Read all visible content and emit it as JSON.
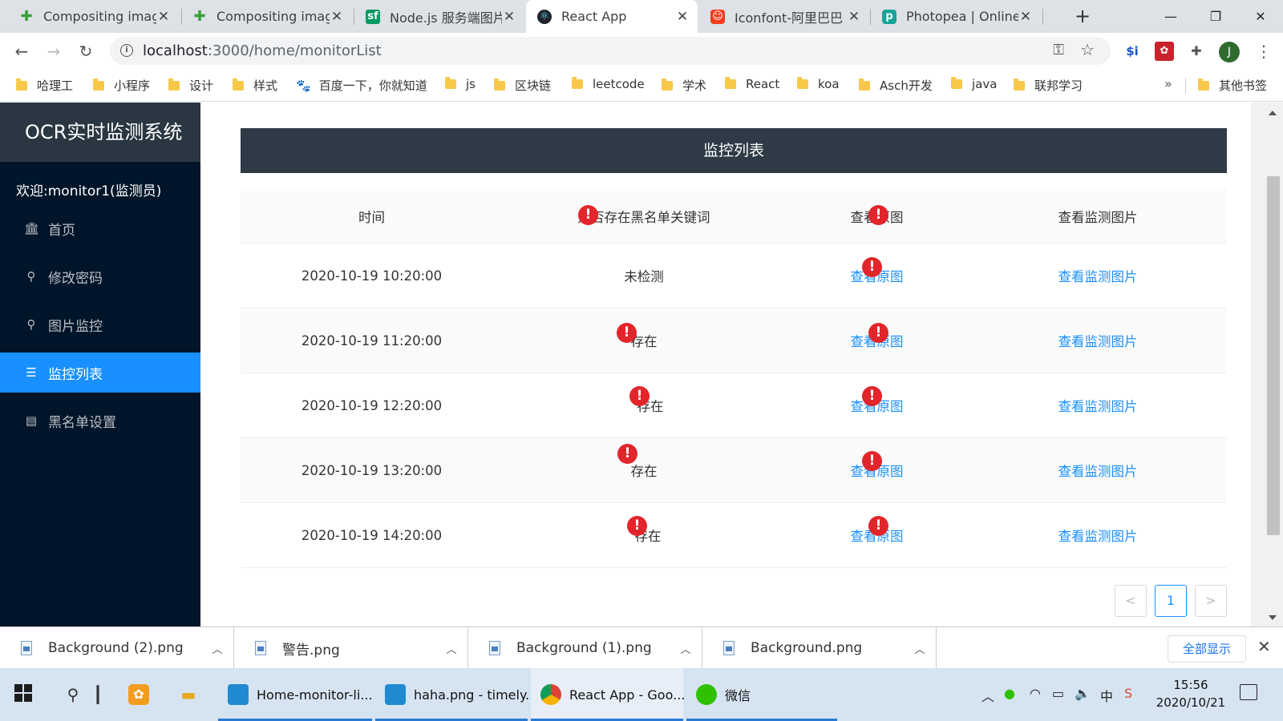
{
  "browser": {
    "tabs": [
      {
        "title": "Compositing image",
        "icon": "puzzle-icon",
        "active": false
      },
      {
        "title": "Compositing image",
        "icon": "puzzle-icon",
        "active": false
      },
      {
        "title": "Node.js 服务端图片",
        "icon": "sf-icon",
        "active": false
      },
      {
        "title": "React App",
        "icon": "react-icon",
        "active": true
      },
      {
        "title": "Iconfont-阿里巴巴",
        "icon": "iconfont-icon",
        "active": false
      },
      {
        "title": "Photopea | Online",
        "icon": "photopea-icon",
        "active": false
      }
    ],
    "url_host": "localhost",
    "url_path": ":3000/home/monitorList",
    "profile_initial": "J",
    "bookmarks": [
      "哈理工",
      "小程序",
      "设计",
      "样式",
      "百度一下，你就知道",
      "js",
      "区块链",
      "leetcode",
      "学术",
      "React",
      "koa",
      "Asch开发",
      "java",
      "联邦学习"
    ],
    "bookmarks_more": "»",
    "other_bookmarks": "其他书签"
  },
  "app": {
    "logo": "OCR实时监测系统",
    "welcome": "欢迎:monitor1(监测员)",
    "menu": [
      {
        "label": "首页",
        "icon": "bank-icon",
        "selected": false
      },
      {
        "label": "修改密码",
        "icon": "search-icon",
        "selected": false
      },
      {
        "label": "图片监控",
        "icon": "search-icon",
        "selected": false
      },
      {
        "label": "监控列表",
        "icon": "list-icon",
        "selected": true
      },
      {
        "label": "黑名单设置",
        "icon": "profile-icon",
        "selected": false
      }
    ],
    "page_title": "监控列表",
    "table": {
      "columns": [
        "时间",
        "是否存在黑名单关键词",
        "查看原图",
        "查看监测图片"
      ],
      "rows": [
        {
          "time": "2020-10-19 10:20:00",
          "status": "未检测",
          "original": "查看原图",
          "monitored": "查看监测图片"
        },
        {
          "time": "2020-10-19 11:20:00",
          "status": "存在",
          "original": "查看原图",
          "monitored": "查看监测图片"
        },
        {
          "time": "2020-10-19 12:20:00",
          "status": "存在",
          "original": "查看原图",
          "monitored": "查看监测图片"
        },
        {
          "time": "2020-10-19 13:20:00",
          "status": "存在",
          "original": "查看原图",
          "monitored": "查看监测图片"
        },
        {
          "time": "2020-10-19 14:20:00",
          "status": "存在",
          "original": "查看原图",
          "monitored": "查看监测图片"
        }
      ]
    },
    "pagination": {
      "prev": "<",
      "current": "1",
      "next": ">"
    },
    "alert_glyph": "!"
  },
  "downloads": {
    "items": [
      "Background (2).png",
      "警告.png",
      "Background (1).png",
      "Background.png"
    ],
    "show_all": "全部显示"
  },
  "taskbar": {
    "apps": [
      "Home-monitor-li...",
      "haha.png - timely...",
      "React App - Goo...",
      "微信"
    ],
    "ime": "中",
    "time": "15:56",
    "date": "2020/10/21"
  },
  "colors": {
    "primary": "#1890ff",
    "sider": "#001529",
    "title_bar": "#2e3b46",
    "alert": "#e2252b"
  }
}
